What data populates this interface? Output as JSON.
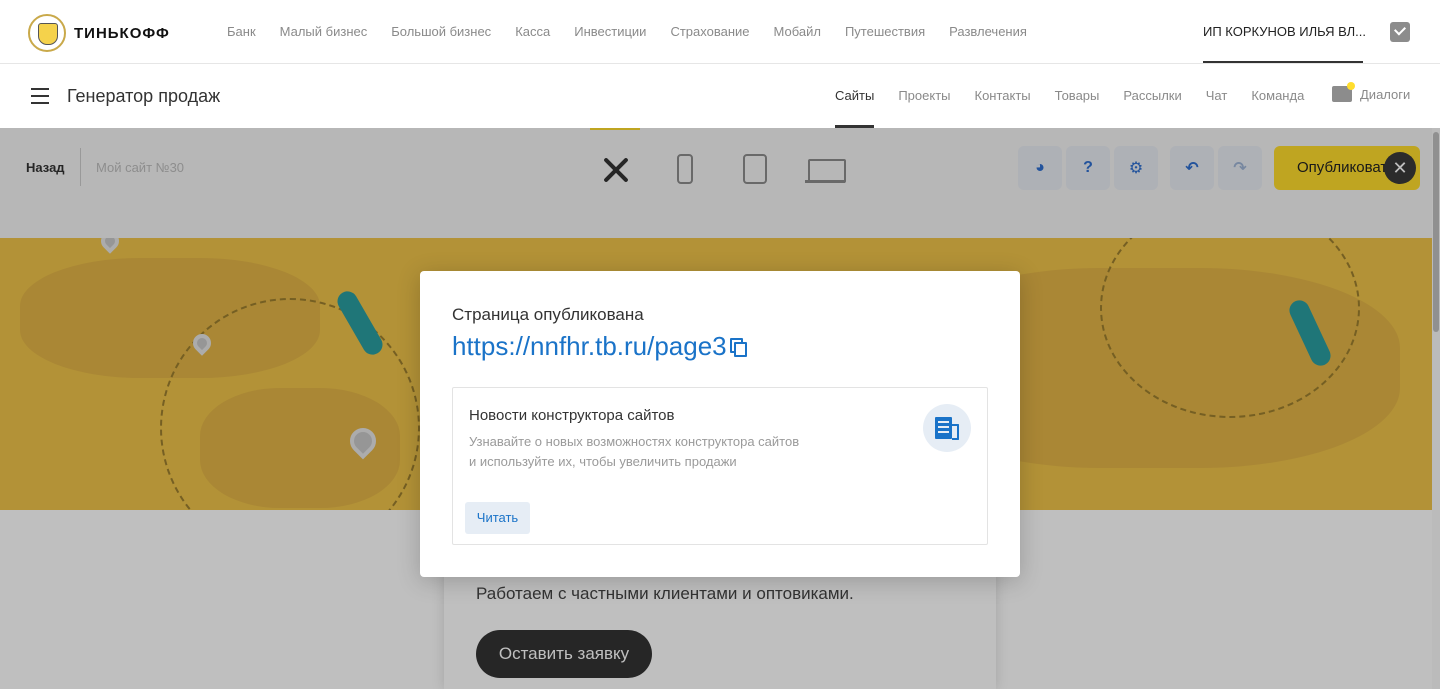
{
  "brand": {
    "logo_text": "ТИНЬКОФФ"
  },
  "topnav": {
    "links": [
      "Банк",
      "Малый бизнес",
      "Большой бизнес",
      "Касса",
      "Инвестиции",
      "Страхование",
      "Мобайл",
      "Путешествия",
      "Развлечения"
    ],
    "account_name": "ИП КОРКУНОВ ИЛЬЯ ВЛ..."
  },
  "subnav": {
    "app_title": "Генератор продаж",
    "links": [
      "Сайты",
      "Проекты",
      "Контакты",
      "Товары",
      "Рассылки",
      "Чат",
      "Команда"
    ],
    "active_index": 0,
    "dialogs_label": "Диалоги"
  },
  "editor": {
    "back_label": "Назад",
    "site_name": "Мой сайт №30",
    "publish_label": "Опубликовать",
    "close_symbol": "✕",
    "tool_icons": [
      "palette-icon",
      "help-icon",
      "settings-icon",
      "undo-icon",
      "redo-icon"
    ]
  },
  "preview": {
    "tagline": "Работаем с частными клиентами и оптовиками.",
    "cta_label": "Оставить заявку",
    "hero_color": "#efc34a"
  },
  "modal": {
    "heading": "Страница опубликована",
    "url": "https://nnfhr.tb.ru/page3",
    "news": {
      "title": "Новости конструктора сайтов",
      "description_line1": "Узнавайте о новых возможностях конструктора сайтов",
      "description_line2": "и используйте их, чтобы увеличить продажи",
      "read_label": "Читать"
    }
  },
  "colors": {
    "accent_yellow": "#ffdd2d",
    "link_blue": "#1a73c8",
    "muted_text": "#8a8a8a"
  }
}
